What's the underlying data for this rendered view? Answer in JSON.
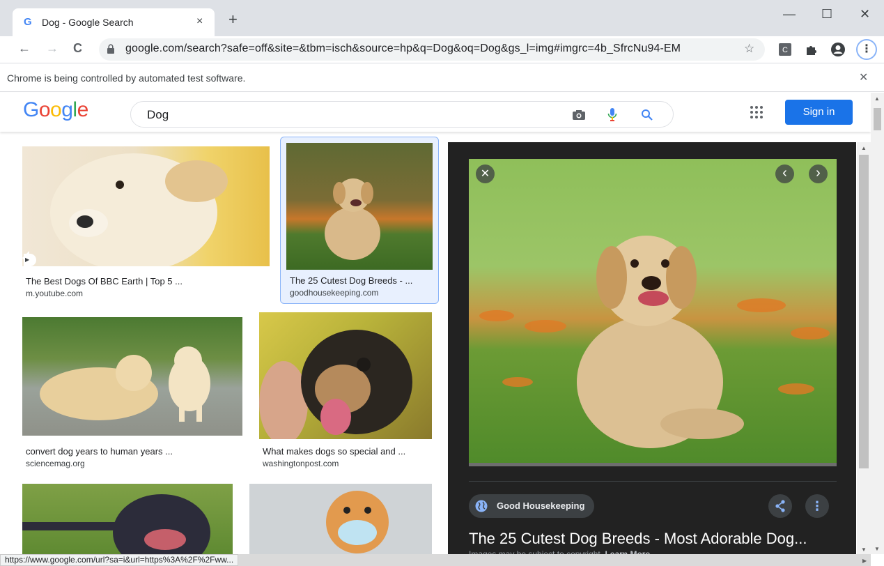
{
  "tab": {
    "title": "Dog - Google Search"
  },
  "omnibox": {
    "url": "google.com/search?safe=off&site=&tbm=isch&source=hp&q=Dog&oq=Dog&gs_l=img#imgrc=4b_SfrcNu94-EM"
  },
  "infobar": {
    "text": "Chrome is being controlled by automated test software."
  },
  "google": {
    "query": "Dog",
    "sign_in": "Sign in",
    "accent": "#1a73e8"
  },
  "results": [
    {
      "title": "The Best Dogs Of BBC Earth | Top 5 ...",
      "source": "m.youtube.com"
    },
    {
      "title": "The 25 Cutest Dog Breeds - ...",
      "source": "goodhousekeeping.com"
    },
    {
      "title": "convert dog years to human years ...",
      "source": "sciencemag.org"
    },
    {
      "title": "What makes dogs so special and ...",
      "source": "washingtonpost.com"
    }
  ],
  "preview": {
    "source": "Good Housekeeping",
    "title": "The 25 Cutest Dog Breeds - Most Adorable Dog...",
    "copyright": "Images may be subject to copyright.",
    "learn_more": "Learn More"
  },
  "status": {
    "url": "https://www.google.com/url?sa=i&url=https%3A%2F%2Fww..."
  },
  "icons": {
    "tab_favicon": "G",
    "tab_close": "×",
    "new_tab": "+",
    "minimize": "—",
    "maximize": "☐",
    "close": "✕",
    "back": "←",
    "forward": "→",
    "reload": "C",
    "star": "☆",
    "menu": "⋮",
    "infobar_close": "✕",
    "panel_close": "✕",
    "prev": "‹",
    "next": "›",
    "more": "⋮"
  }
}
